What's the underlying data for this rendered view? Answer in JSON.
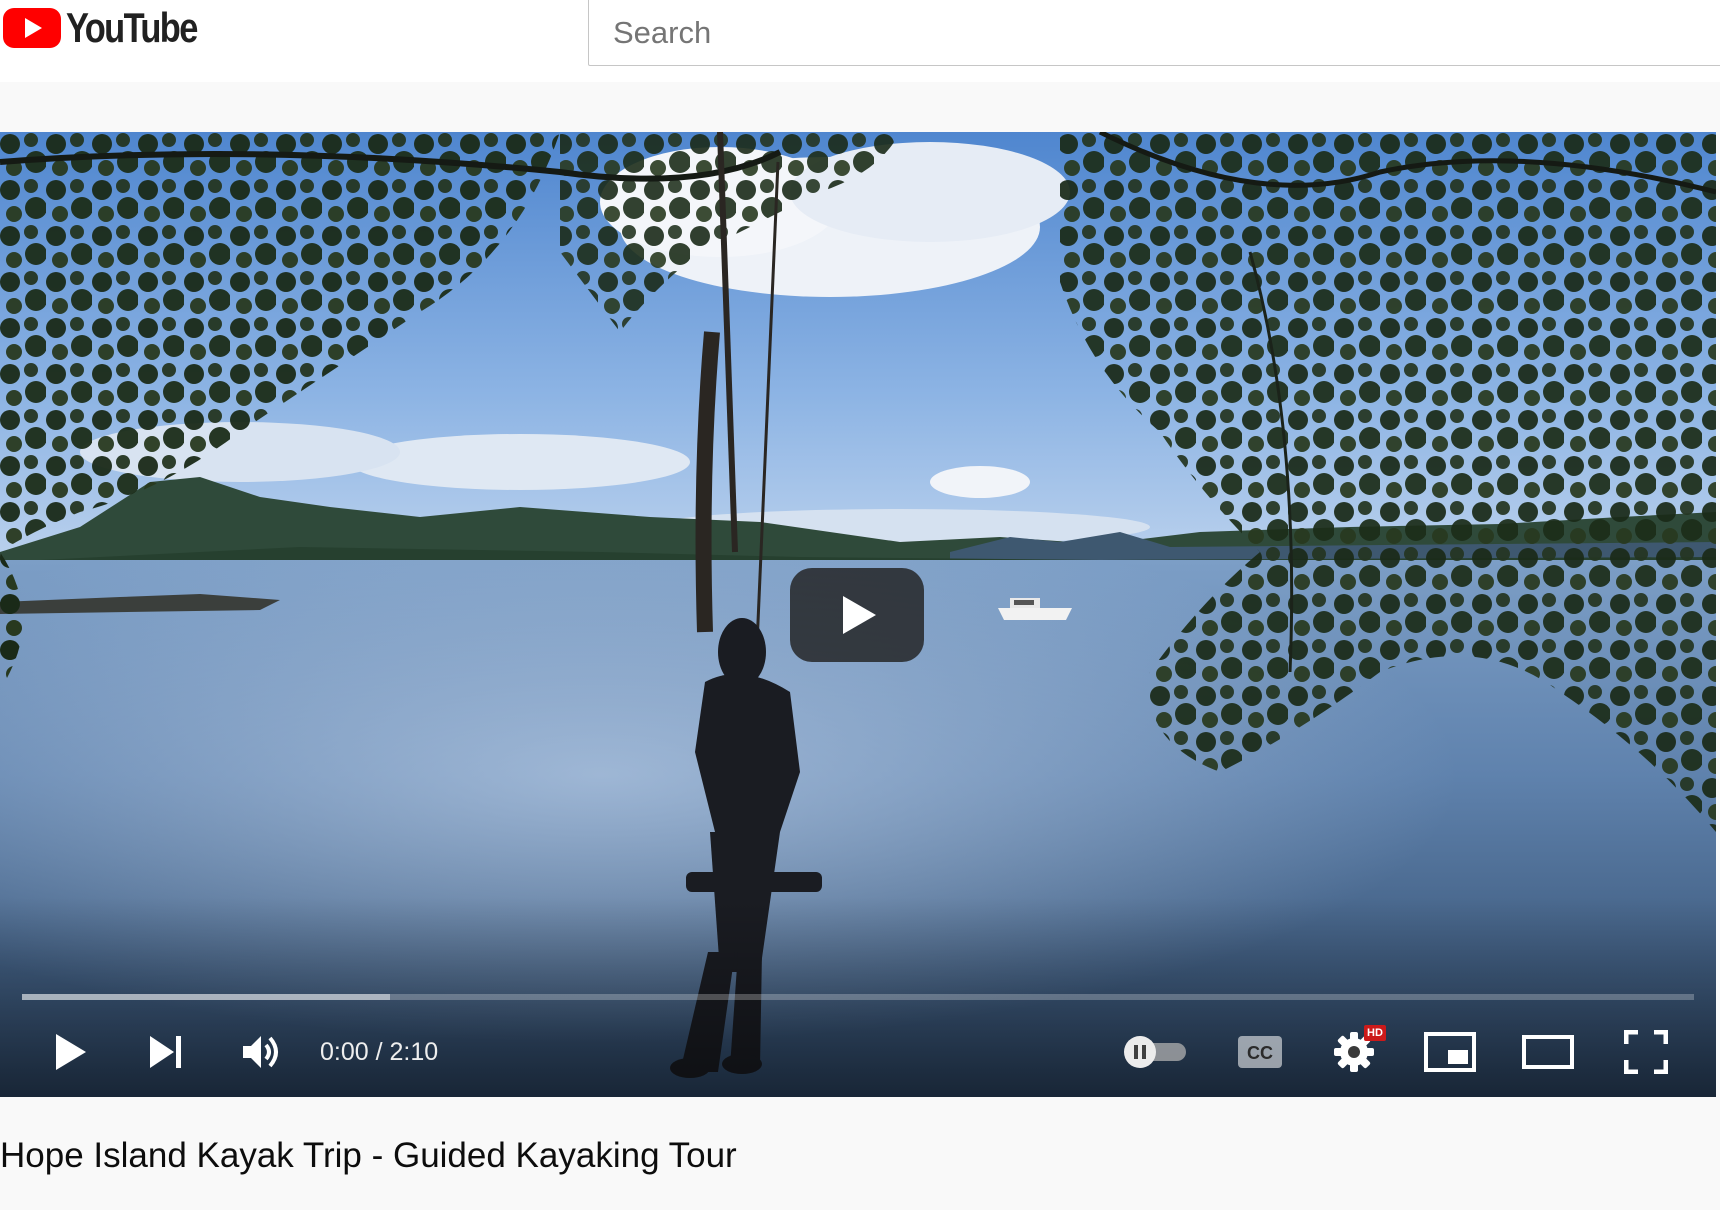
{
  "header": {
    "logo_text": "YouTube",
    "search_placeholder": "Search",
    "search_value": ""
  },
  "player": {
    "current_time": "0:00",
    "duration": "2:10",
    "time_display": "0:00 / 2:10",
    "buffered_fraction": 0.22,
    "played_fraction": 0.0,
    "hd_badge": "HD",
    "autoplay_on": false,
    "icons": [
      "play-icon",
      "next-icon",
      "volume-icon",
      "autoplay-toggle-icon",
      "captions-icon",
      "settings-icon",
      "miniplayer-icon",
      "theater-mode-icon",
      "fullscreen-icon",
      "large-play-icon"
    ]
  },
  "video": {
    "title": "Hope Island Kayak Trip - Guided Kayaking Tour"
  },
  "colors": {
    "brand_red": "#ff0000",
    "hd_badge": "#cc1a1a",
    "page_bg": "#f9f9f9"
  }
}
